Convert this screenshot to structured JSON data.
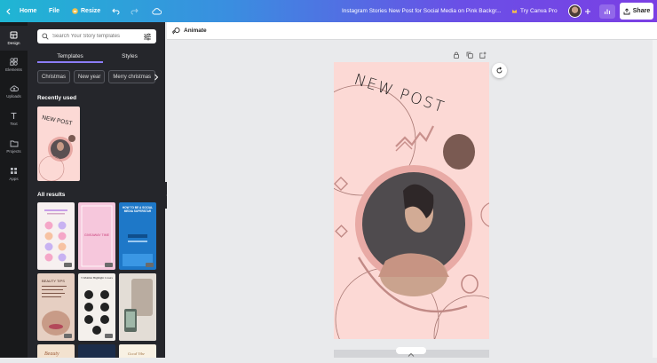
{
  "topbar": {
    "home_label": "Home",
    "file_label": "File",
    "resize_label": "Resize",
    "doc_title": "Instagram Stories New Post for Social Media on Pink Backgr...",
    "try_pro_label": "Try Canva Pro",
    "share_label": "Share"
  },
  "rail": {
    "items": [
      {
        "label": "Design"
      },
      {
        "label": "Elements"
      },
      {
        "label": "Uploads"
      },
      {
        "label": "Text"
      },
      {
        "label": "Projects"
      },
      {
        "label": "Apps"
      }
    ]
  },
  "panel": {
    "search_placeholder": "Search Your Story templates",
    "tabs": [
      "Templates",
      "Styles"
    ],
    "chips": [
      "Christmas",
      "New year",
      "Merry christmas"
    ],
    "recently_used_label": "Recently used",
    "all_results_label": "All results",
    "recent_thumb_text": "NEW POST",
    "results": [
      {
        "text": ""
      },
      {
        "text": "GIVEAWAY TIME"
      },
      {
        "text": "HOW TO BE A SOCIAL MEDIA SUPERSTAR"
      },
      {
        "text": "BEAUTY TIPS"
      },
      {
        "text": "5 Wishlist Highlight Covers"
      },
      {
        "text": ""
      },
      {
        "text": "Beauty"
      },
      {
        "text": ""
      },
      {
        "text": "Good Vibe"
      }
    ]
  },
  "editor": {
    "animate_label": "Animate",
    "canvas_text": "NEW POST",
    "colors": {
      "canvas_bg": "#fcd9d5",
      "accent": "#8b7cf6",
      "brown": "#7a5a52"
    }
  }
}
